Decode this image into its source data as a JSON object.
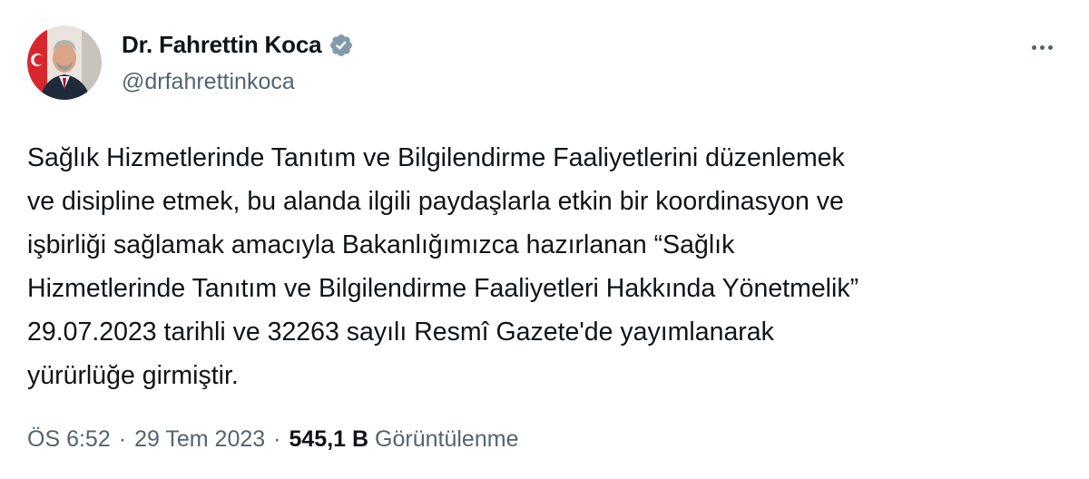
{
  "author": {
    "name": "Dr. Fahrettin Koca",
    "handle": "@drfahrettinkoca",
    "verified": true,
    "verified_color": "#829aab"
  },
  "tweet": {
    "text": "Sağlık Hizmetlerinde Tanıtım ve Bilgilendirme Faaliyetlerini düzenlemek\nve disipline etmek, bu alanda ilgili paydaşlarla etkin bir koordinasyon ve\nişbirliği sağlamak amacıyla Bakanlığımızca hazırlanan “Sağlık\nHizmetlerinde Tanıtım ve Bilgilendirme Faaliyetleri Hakkında Yönetmelik”\n29.07.2023 tarihli ve 32263 sayılı Resmî Gazete'de yayımlanarak\nyürürlüğe girmiştir."
  },
  "meta": {
    "time": "ÖS 6:52",
    "separator": "·",
    "date": "29 Tem 2023",
    "views_count": "545,1 B",
    "views_label": "Görüntülenme"
  },
  "icons": {
    "more": "more-horizontal-icon",
    "verified": "verified-badge-icon"
  },
  "colors": {
    "text_primary": "#0f1419",
    "text_secondary": "#536471"
  }
}
